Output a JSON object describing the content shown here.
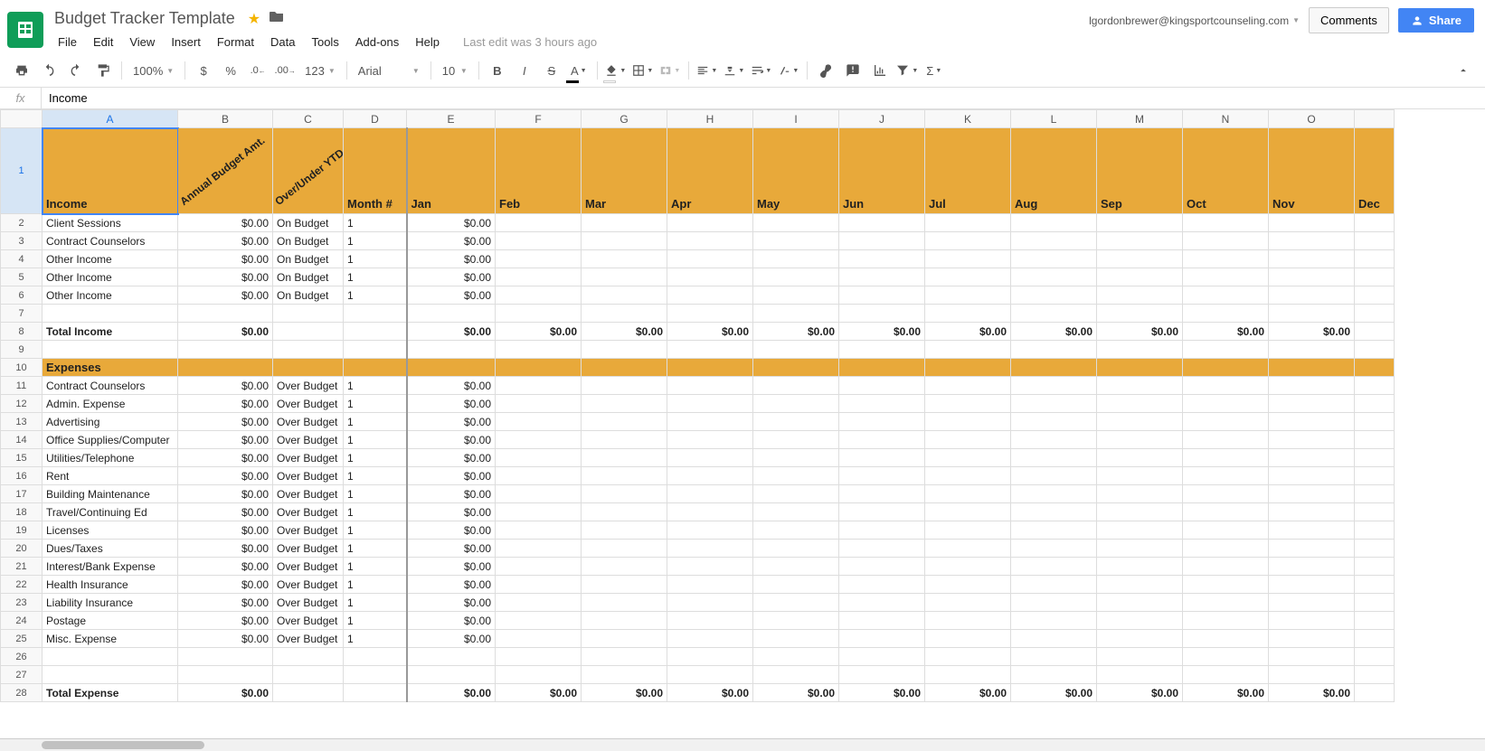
{
  "title": "Budget Tracker Template",
  "lastEdit": "Last edit was 3 hours ago",
  "userEmail": "lgordonbrewer@kingsportcounseling.com",
  "commentsLabel": "Comments",
  "shareLabel": "Share",
  "menu": [
    "File",
    "Edit",
    "View",
    "Insert",
    "Format",
    "Data",
    "Tools",
    "Add-ons",
    "Help"
  ],
  "zoom": "100%",
  "font": "Arial",
  "fontSize": "10",
  "fxValue": "Income",
  "cols": [
    "A",
    "B",
    "C",
    "D",
    "E",
    "F",
    "G",
    "H",
    "I",
    "J",
    "K",
    "L",
    "M",
    "N",
    "O"
  ],
  "colWidths": [
    "wA",
    "wB",
    "wC",
    "wD thick-r",
    "wE",
    "wM",
    "wM",
    "wM",
    "wM",
    "wM",
    "wM",
    "wM",
    "wM",
    "wM",
    "wM"
  ],
  "headerRow": {
    "A": "Income",
    "B": "Annual Budget Amt.",
    "C": "Over/Under YTD",
    "D": "Month #",
    "E": "Jan",
    "F": "Feb",
    "G": "Mar",
    "H": "Apr",
    "I": "May",
    "J": "Jun",
    "K": "Jul",
    "L": "Aug",
    "M": "Sep",
    "N": "Oct",
    "O": "Nov",
    "P": "Dec"
  },
  "rotatedCols": [
    "B",
    "C"
  ],
  "rows": [
    {
      "n": 2,
      "A": "Client Sessions",
      "B": "$0.00",
      "C": "On Budget",
      "D": "1",
      "E": "$0.00"
    },
    {
      "n": 3,
      "A": "Contract Counselors",
      "B": "$0.00",
      "C": "On Budget",
      "D": "1",
      "E": "$0.00"
    },
    {
      "n": 4,
      "A": "Other Income",
      "B": "$0.00",
      "C": "On Budget",
      "D": "1",
      "E": "$0.00"
    },
    {
      "n": 5,
      "A": "Other Income",
      "B": "$0.00",
      "C": "On Budget",
      "D": "1",
      "E": "$0.00"
    },
    {
      "n": 6,
      "A": "Other Income",
      "B": "$0.00",
      "C": "On Budget",
      "D": "1",
      "E": "$0.00"
    },
    {
      "n": 7
    },
    {
      "n": 8,
      "bold": true,
      "A": "Total Income",
      "B": "$0.00",
      "E": "$0.00",
      "F": "$0.00",
      "G": "$0.00",
      "H": "$0.00",
      "I": "$0.00",
      "J": "$0.00",
      "K": "$0.00",
      "L": "$0.00",
      "M": "$0.00",
      "N": "$0.00",
      "O": "$0.00"
    },
    {
      "n": 9
    },
    {
      "n": 10,
      "section": true,
      "A": "Expenses"
    },
    {
      "n": 11,
      "A": "Contract Counselors",
      "B": "$0.00",
      "C": "Over Budget",
      "D": "1",
      "E": "$0.00"
    },
    {
      "n": 12,
      "A": "Admin. Expense",
      "B": "$0.00",
      "C": "Over Budget",
      "D": "1",
      "E": "$0.00"
    },
    {
      "n": 13,
      "A": "Advertising",
      "B": "$0.00",
      "C": "Over Budget",
      "D": "1",
      "E": "$0.00"
    },
    {
      "n": 14,
      "A": "Office Supplies/Computer",
      "B": "$0.00",
      "C": "Over Budget",
      "D": "1",
      "E": "$0.00"
    },
    {
      "n": 15,
      "A": "Utilities/Telephone",
      "B": "$0.00",
      "C": "Over Budget",
      "D": "1",
      "E": "$0.00"
    },
    {
      "n": 16,
      "A": "Rent",
      "B": "$0.00",
      "C": "Over Budget",
      "D": "1",
      "E": "$0.00"
    },
    {
      "n": 17,
      "A": "Building Maintenance",
      "B": "$0.00",
      "C": "Over Budget",
      "D": "1",
      "E": "$0.00"
    },
    {
      "n": 18,
      "A": "Travel/Continuing Ed",
      "B": "$0.00",
      "C": "Over Budget",
      "D": "1",
      "E": "$0.00"
    },
    {
      "n": 19,
      "A": "Licenses",
      "B": "$0.00",
      "C": "Over Budget",
      "D": "1",
      "E": "$0.00"
    },
    {
      "n": 20,
      "A": "Dues/Taxes",
      "B": "$0.00",
      "C": "Over Budget",
      "D": "1",
      "E": "$0.00"
    },
    {
      "n": 21,
      "A": "Interest/Bank Expense",
      "B": "$0.00",
      "C": "Over Budget",
      "D": "1",
      "E": "$0.00"
    },
    {
      "n": 22,
      "A": "Health Insurance",
      "B": "$0.00",
      "C": "Over Budget",
      "D": "1",
      "E": "$0.00"
    },
    {
      "n": 23,
      "A": "Liability Insurance",
      "B": "$0.00",
      "C": "Over Budget",
      "D": "1",
      "E": "$0.00"
    },
    {
      "n": 24,
      "A": "Postage",
      "B": "$0.00",
      "C": "Over Budget",
      "D": "1",
      "E": "$0.00"
    },
    {
      "n": 25,
      "A": "Misc. Expense",
      "B": "$0.00",
      "C": "Over Budget",
      "D": "1",
      "E": "$0.00"
    },
    {
      "n": 26
    },
    {
      "n": 27
    },
    {
      "n": 28,
      "bold": true,
      "A": "Total Expense",
      "B": "$0.00",
      "E": "$0.00",
      "F": "$0.00",
      "G": "$0.00",
      "H": "$0.00",
      "I": "$0.00",
      "J": "$0.00",
      "K": "$0.00",
      "L": "$0.00",
      "M": "$0.00",
      "N": "$0.00",
      "O": "$0.00"
    }
  ],
  "numCols": [
    "B",
    "E",
    "F",
    "G",
    "H",
    "I",
    "J",
    "K",
    "L",
    "M",
    "N",
    "O"
  ],
  "lastColHeader": "Dec"
}
